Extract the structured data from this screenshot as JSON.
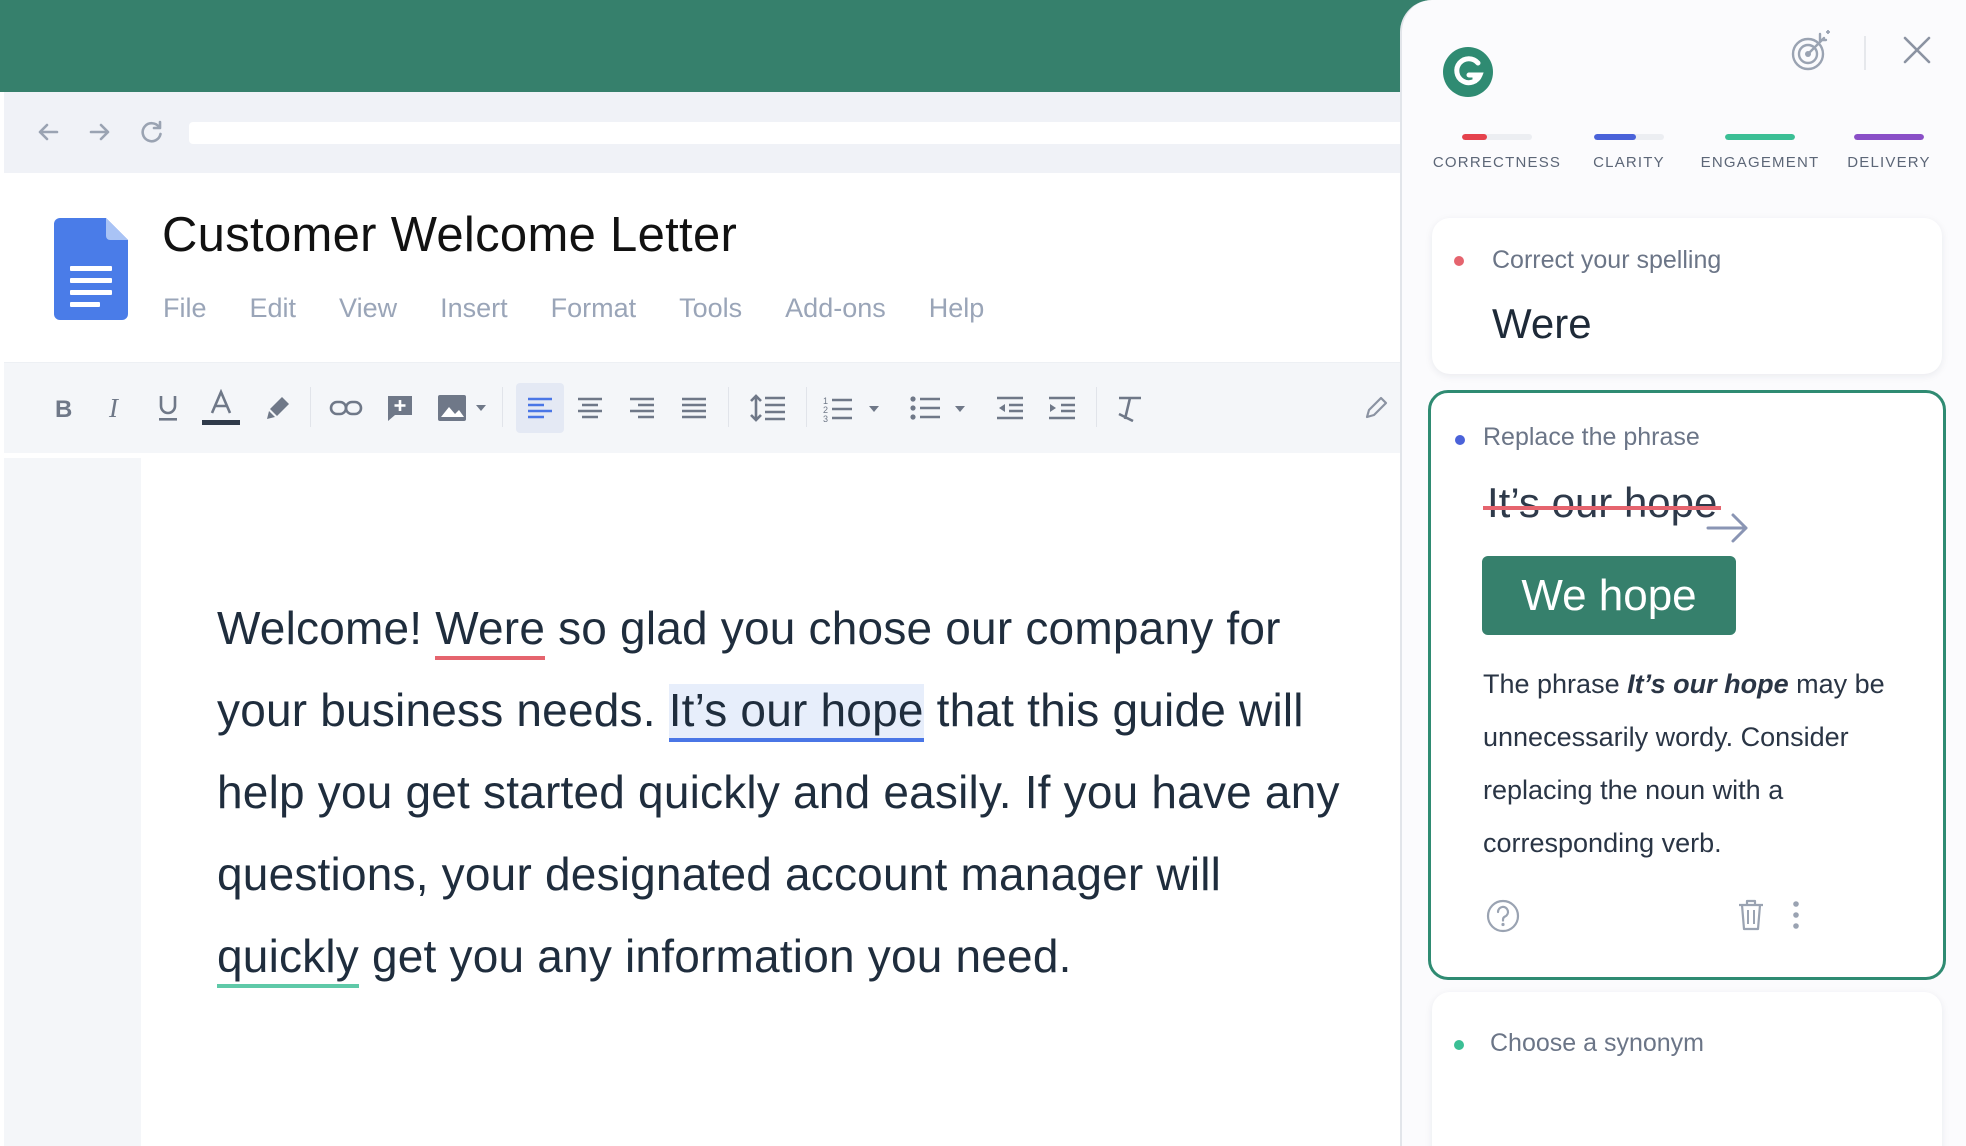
{
  "browser": {
    "back_icon": "arrow-left-icon",
    "forward_icon": "arrow-right-icon",
    "reload_icon": "reload-icon"
  },
  "doc": {
    "title": "Customer Welcome Letter",
    "menu": [
      "File",
      "Edit",
      "View",
      "Insert",
      "Format",
      "Tools",
      "Add-ons",
      "Help"
    ],
    "toolbar_icons": [
      "bold-icon",
      "italic-icon",
      "underline-icon",
      "text-color-icon",
      "highlight-icon",
      "link-icon",
      "comment-icon",
      "image-icon",
      "align-left-icon",
      "align-center-icon",
      "align-right-icon",
      "justify-icon",
      "line-spacing-icon",
      "numbered-list-icon",
      "bulleted-list-icon",
      "decrease-indent-icon",
      "increase-indent-icon",
      "clear-formatting-icon",
      "edit-pencil-icon"
    ],
    "body": {
      "p1": "Welcome! ",
      "err1": "Were",
      "p2": " so glad you chose our company for your business needs. ",
      "err2": "It’s our hope",
      "p3": " that this guide will help you get started quickly and easily. If you have any questions, your designated account manager will ",
      "err3": "quickly",
      "p4": " get you any information you need."
    }
  },
  "grammarly": {
    "categories": [
      {
        "label": "CORRECTNESS",
        "color": "#e5424d",
        "fill": 0.35
      },
      {
        "label": "CLARITY",
        "color": "#4a62d9",
        "fill": 0.6
      },
      {
        "label": "ENGAGEMENT",
        "color": "#3bbf95",
        "fill": 1.0
      },
      {
        "label": "DELIVERY",
        "color": "#8a4fc7",
        "fill": 1.0
      }
    ],
    "cards": {
      "spelling": {
        "header": "Correct your spelling",
        "word": "Were"
      },
      "phrase": {
        "header": "Replace the phrase",
        "original": "It’s our hope",
        "replacement": "We hope",
        "explain_a": "The phrase ",
        "explain_b": "It’s our hope",
        "explain_c": " may be unnecessarily wordy. Consider replacing the noun with a corresponding verb."
      },
      "synonym": {
        "header": "Choose a synonym"
      }
    },
    "colors": {
      "brand": "#36806c",
      "error": "#e5646e",
      "clarity": "#4a76e6",
      "engagement": "#3bbf95"
    }
  }
}
